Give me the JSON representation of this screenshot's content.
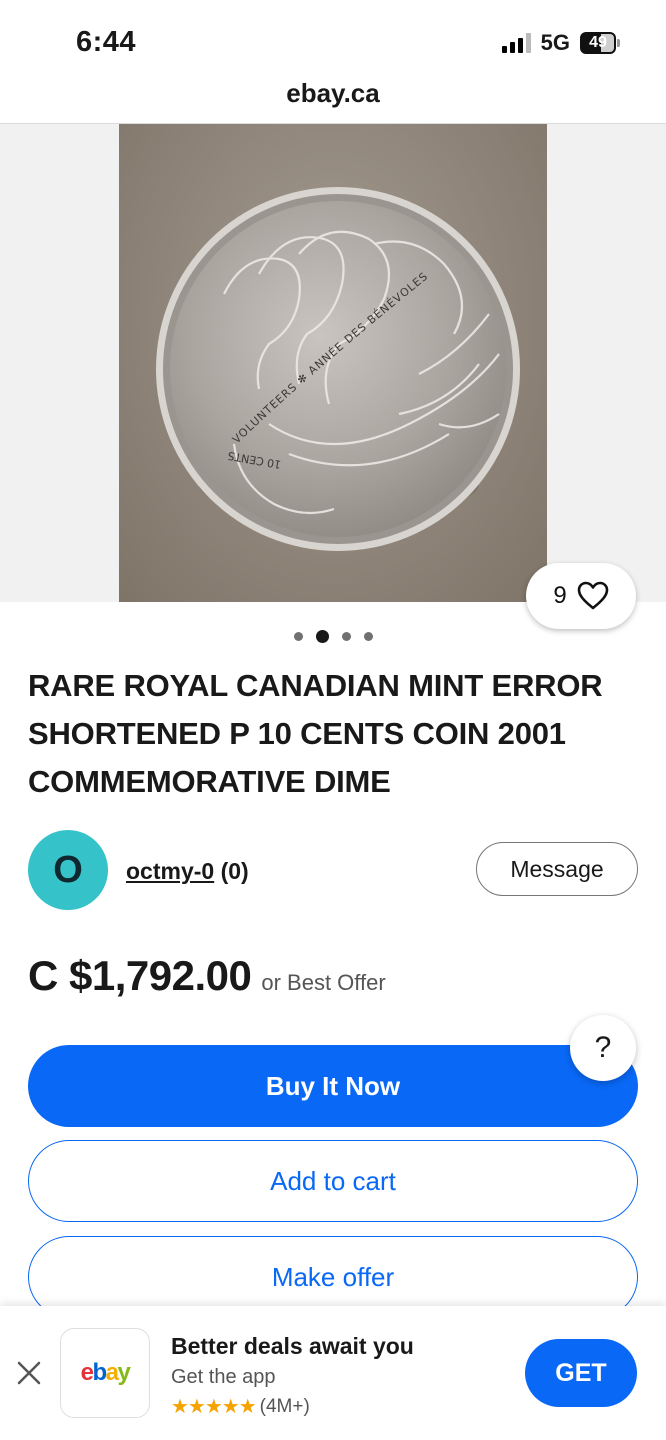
{
  "status_bar": {
    "time": "6:44",
    "network": "5G",
    "battery": "49"
  },
  "browser": {
    "url": "ebay.ca"
  },
  "gallery": {
    "image_count": 4,
    "active_index": 1,
    "favorite_count": "9",
    "coin_inscription": "VOLUNTEERS ✻ ANNÉE DES BÉNÉVOLES",
    "coin_inscription_bottom": "10 CENTS"
  },
  "listing": {
    "title": "RARE ROYAL CANADIAN MINT ERROR SHORTENED P 10 CENTS COIN 2001 COMMEMORATIVE DIME",
    "seller": {
      "avatar_letter": "O",
      "name": "octmy-0",
      "feedback": "(0)"
    },
    "message_label": "Message",
    "price": "C $1,792.00",
    "price_suffix": "or Best Offer"
  },
  "actions": {
    "buy_now": "Buy It Now",
    "add_to_cart": "Add to cart",
    "make_offer": "Make offer",
    "help": "?"
  },
  "app_banner": {
    "title": "Better deals await you",
    "subtitle": "Get the app",
    "stars": "★★★★★",
    "rating_count": "(4M+)",
    "cta": "GET",
    "logo_letters": [
      "e",
      "b",
      "a",
      "y"
    ]
  },
  "colors": {
    "primary": "#0968f6",
    "avatar": "#35c2c8",
    "text": "#191919"
  }
}
